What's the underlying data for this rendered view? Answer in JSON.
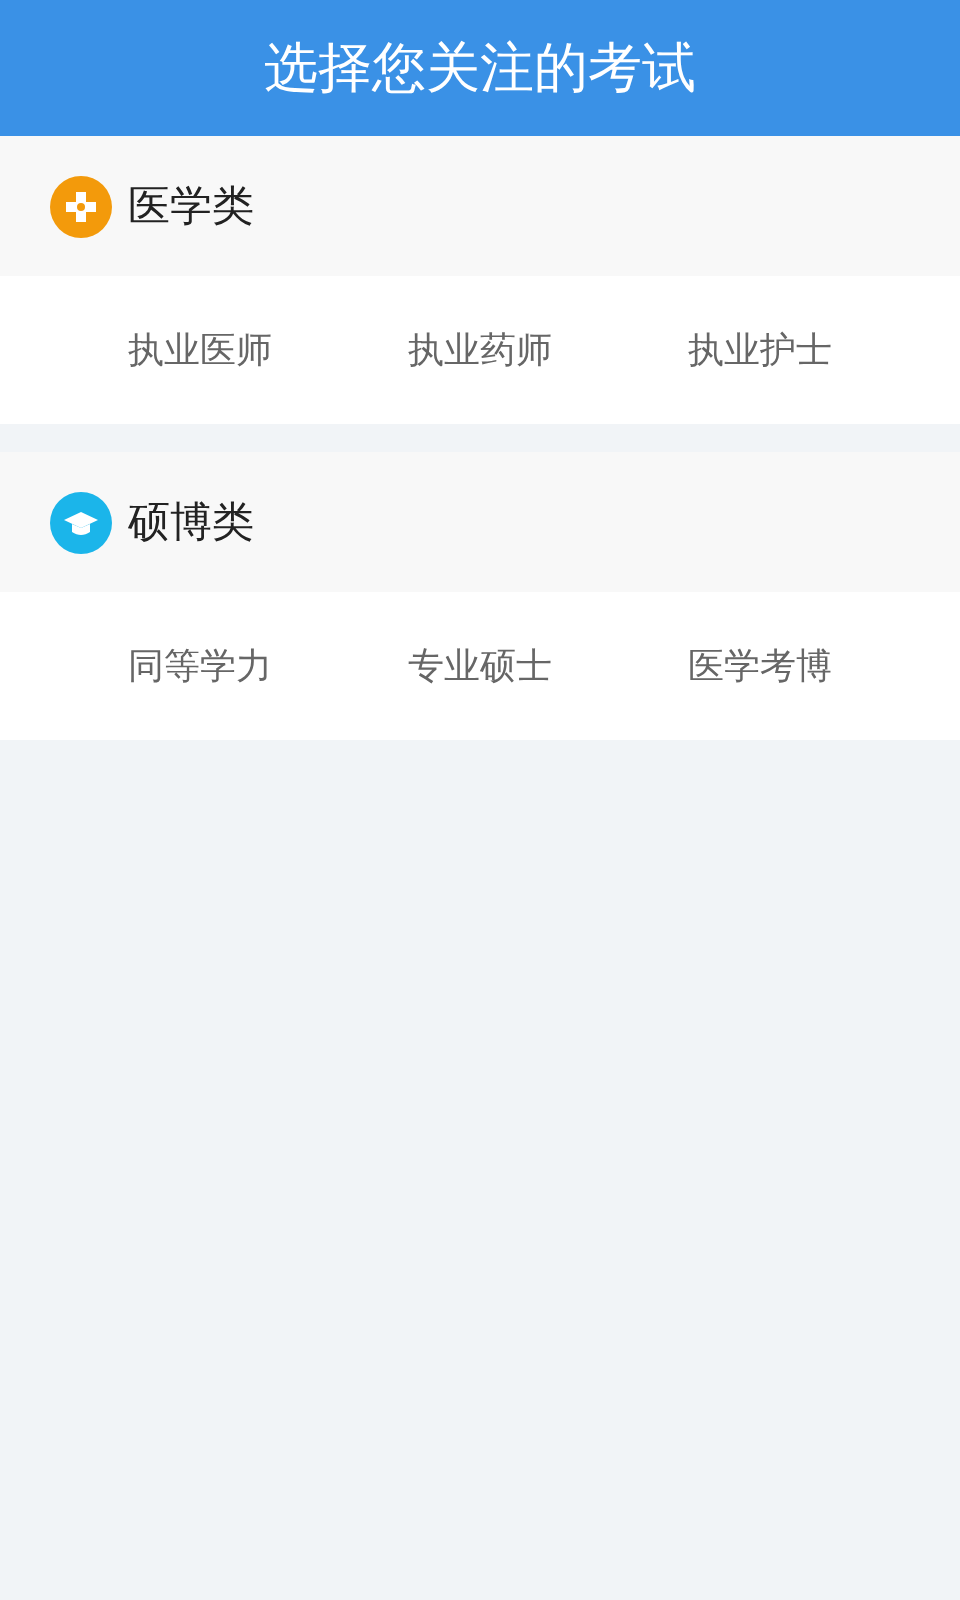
{
  "header": {
    "title": "选择您关注的考试"
  },
  "categories": [
    {
      "title": "医学类",
      "kind": "medical",
      "color": "#f39a0b",
      "items": [
        "执业医师",
        "执业药师",
        "执业护士"
      ]
    },
    {
      "title": "硕博类",
      "kind": "degree",
      "color": "#1bb5ea",
      "items": [
        "同等学力",
        "专业硕士",
        "医学考博"
      ]
    }
  ]
}
